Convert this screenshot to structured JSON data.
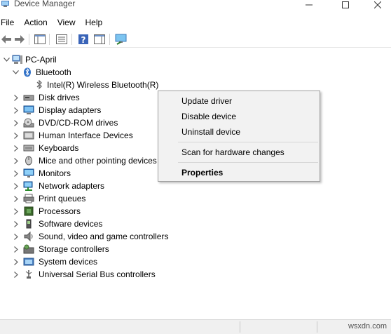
{
  "window": {
    "title": "Device Manager"
  },
  "menu": [
    "File",
    "Action",
    "View",
    "Help"
  ],
  "toolbar": {
    "icons": [
      "back-icon",
      "forward-icon",
      "show-hide-console-tree-icon",
      "properties-icon",
      "help-icon",
      "view-icon",
      "scan-hardware-icon"
    ]
  },
  "tree": {
    "root": "PC-April",
    "bluetooth": {
      "label": "Bluetooth",
      "child": "Intel(R) Wireless Bluetooth(R)"
    },
    "categories": [
      {
        "label": "Disk drives",
        "icon": "disk-drive-icon"
      },
      {
        "label": "Display adapters",
        "icon": "display-adapter-icon"
      },
      {
        "label": "DVD/CD-ROM drives",
        "icon": "dvd-drive-icon"
      },
      {
        "label": "Human Interface Devices",
        "icon": "hid-icon"
      },
      {
        "label": "Keyboards",
        "icon": "keyboard-icon"
      },
      {
        "label": "Mice and other pointing devices",
        "icon": "mouse-icon"
      },
      {
        "label": "Monitors",
        "icon": "monitor-icon"
      },
      {
        "label": "Network adapters",
        "icon": "network-adapter-icon"
      },
      {
        "label": "Print queues",
        "icon": "printer-icon"
      },
      {
        "label": "Processors",
        "icon": "processor-icon"
      },
      {
        "label": "Software devices",
        "icon": "software-device-icon"
      },
      {
        "label": "Sound, video and game controllers",
        "icon": "speaker-icon"
      },
      {
        "label": "Storage controllers",
        "icon": "storage-controller-icon"
      },
      {
        "label": "System devices",
        "icon": "system-device-icon"
      },
      {
        "label": "Universal Serial Bus controllers",
        "icon": "usb-icon"
      }
    ]
  },
  "context_menu": {
    "items": [
      "Update driver",
      "Disable device",
      "Uninstall device",
      "Scan for hardware changes",
      "Properties"
    ]
  },
  "status": {
    "watermark": "wsxdn.com"
  }
}
